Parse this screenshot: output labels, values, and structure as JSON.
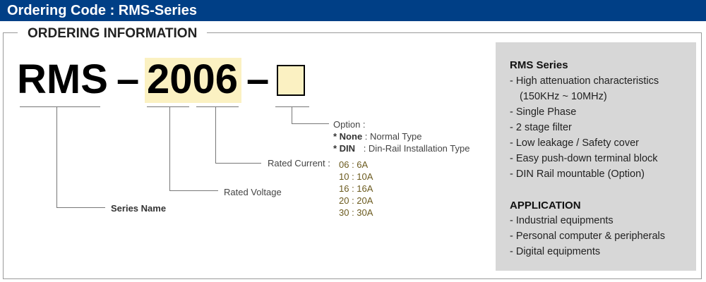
{
  "header": {
    "title": "Ordering Code : RMS-Series"
  },
  "section_title": "ORDERING INFORMATION",
  "code": {
    "series": "RMS",
    "dash1": "–",
    "model": "2006",
    "dash2": "–"
  },
  "option": {
    "label": "Option :",
    "none_key": "* None",
    "none_desc": ": Normal Type",
    "din_key": "* DIN",
    "din_desc": ": Din-Rail Installation Type"
  },
  "rated_current": {
    "label": "Rated Current :",
    "values": [
      "06 : 6A",
      "10 : 10A",
      "16 : 16A",
      "20 : 20A",
      "30 : 30A"
    ]
  },
  "rated_voltage": {
    "label": "Rated Voltage"
  },
  "series_name": {
    "label": "Series Name"
  },
  "panel": {
    "series_title": "RMS Series",
    "features": [
      "- High attenuation characteristics",
      "(150KHz ~ 10MHz)",
      "- Single Phase",
      "- 2 stage filter",
      "- Low leakage / Safety cover",
      "- Easy push-down terminal block",
      "- DIN Rail mountable (Option)"
    ],
    "application_title": "APPLICATION",
    "applications": [
      "- Industrial equipments",
      "- Personal computer & peripherals",
      "- Digital equipments"
    ]
  },
  "colors": {
    "header_bg": "#003f86",
    "highlight": "#fbf1c2",
    "panel_bg": "#d7d7d7",
    "current_text": "#6b5a1e"
  }
}
